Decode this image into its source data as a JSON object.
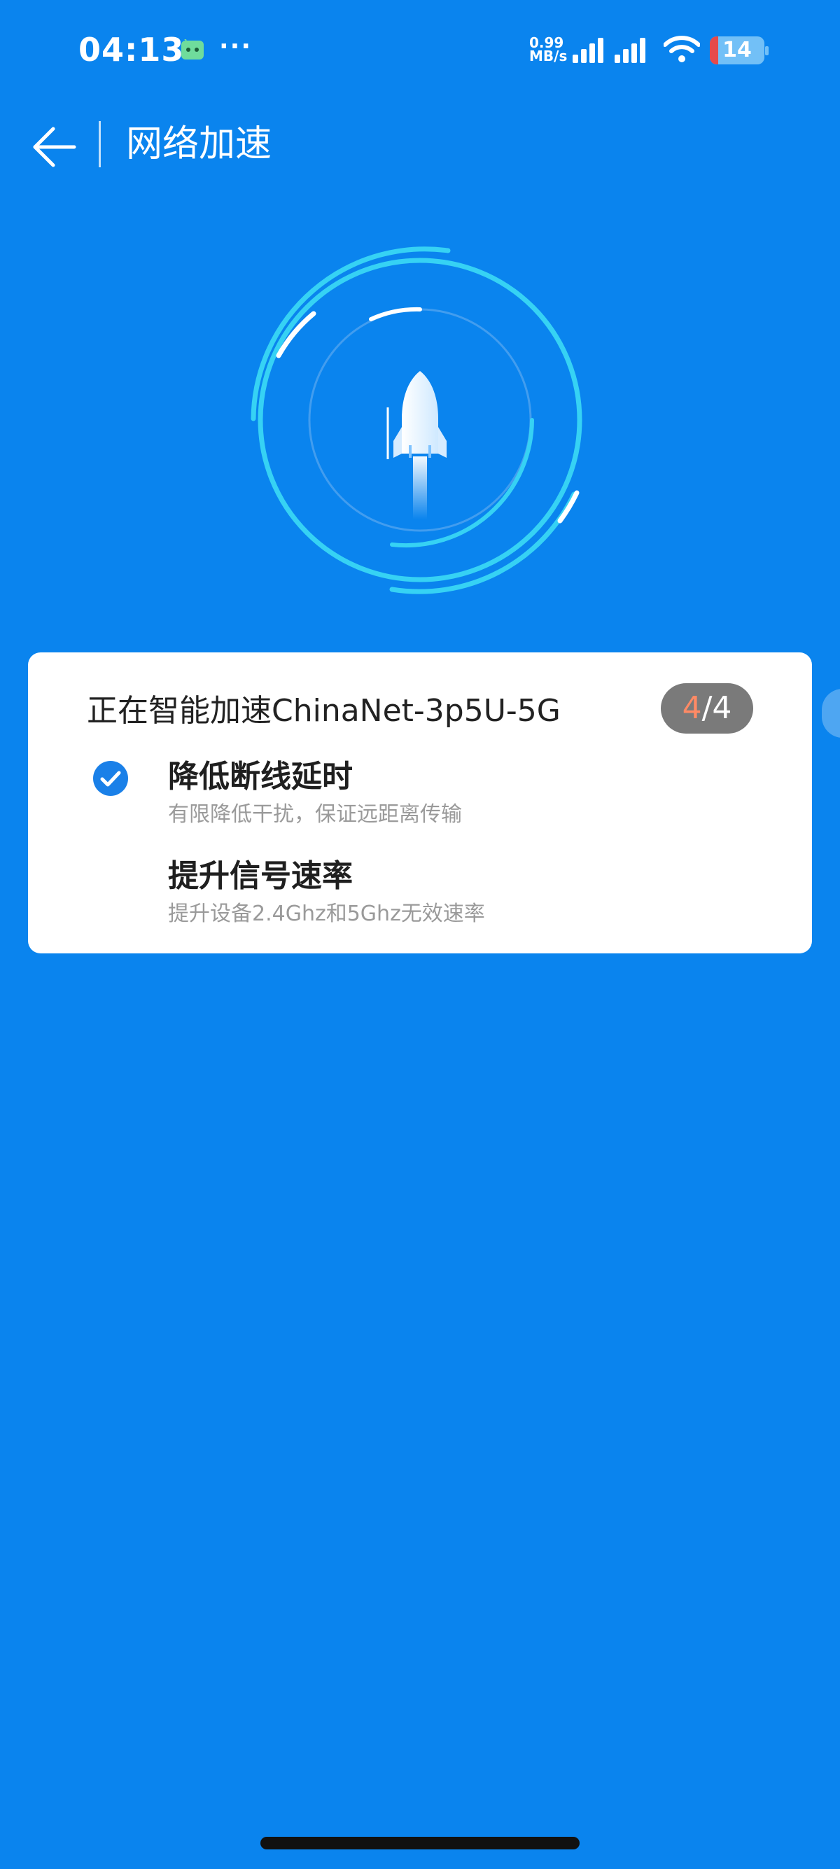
{
  "status_bar": {
    "time": "04:13",
    "more_dots": "···",
    "net_speed_value": "0.99",
    "net_speed_unit": "MB/s",
    "battery_level": "14",
    "icons": [
      "android-icon",
      "signal-icon",
      "wifi-icon",
      "battery-icon"
    ]
  },
  "header": {
    "title": "网络加速",
    "back_icon": "arrow-left-icon"
  },
  "accelerator": {
    "graphic": "rocket-icon"
  },
  "card": {
    "title": "正在智能加速ChinaNet-3p5U-5G",
    "step_current": "4",
    "step_separator": "/",
    "step_total": "4",
    "items": [
      {
        "title": "降低断线延时",
        "desc": "有限降低干扰，保证远距离传输",
        "checked": true,
        "icon": "check-circle-icon"
      },
      {
        "title": "提升信号速率",
        "desc": "提升设备2.4Ghz和5Ghz无效速率",
        "checked": false
      }
    ]
  },
  "colors": {
    "background": "#0a84ee",
    "ring": "#36d2f4",
    "accent": "#1a80e8",
    "step_current": "#ff8a65"
  }
}
